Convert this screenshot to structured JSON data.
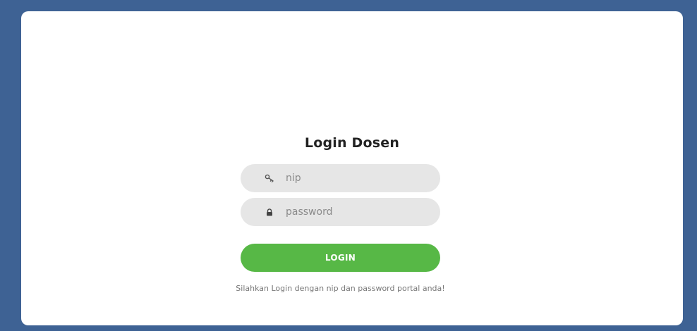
{
  "form": {
    "title": "Login Dosen",
    "nip_placeholder": "nip",
    "password_placeholder": "password",
    "login_label": "LOGIN",
    "hint_text": "Silahkan Login dengan nip dan password portal anda!"
  },
  "icons": {
    "nip": "key-icon",
    "password": "lock-icon"
  },
  "colors": {
    "background": "#3e6294",
    "button": "#57b846",
    "field": "#e6e6e6"
  }
}
